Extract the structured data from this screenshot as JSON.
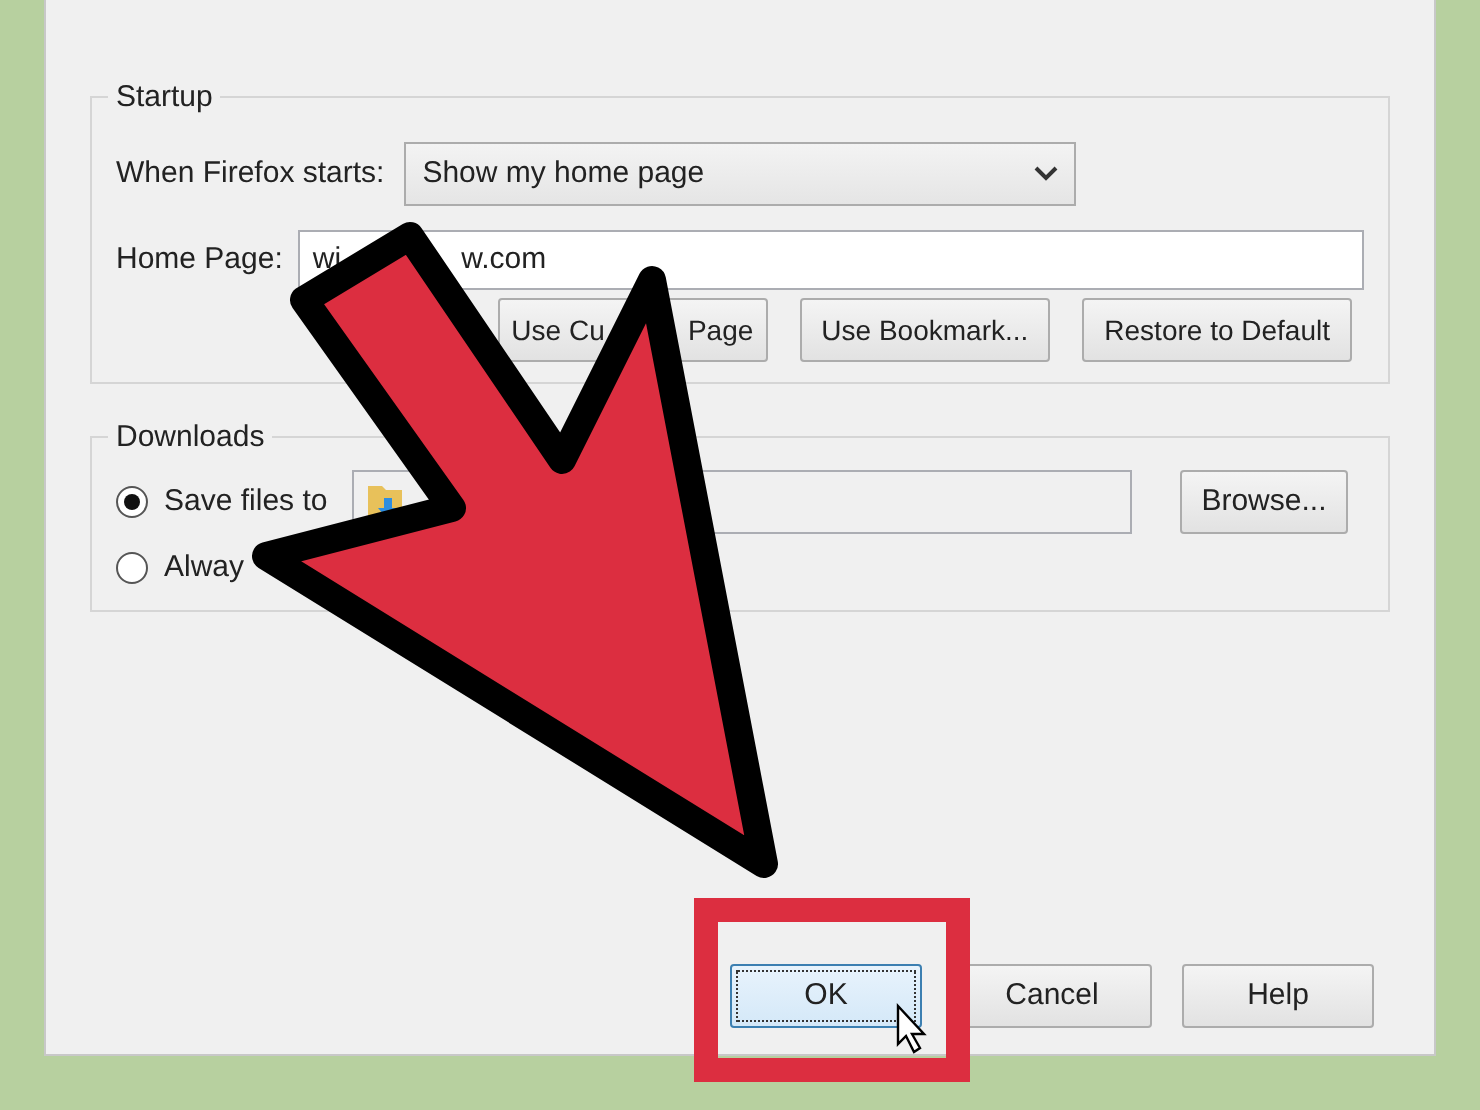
{
  "startup": {
    "title": "Startup",
    "when_label": "When Firefox starts:",
    "when_value": "Show my home page",
    "home_label": "Home Page:",
    "home_value_parts": [
      "wi",
      "w.com"
    ],
    "buttons": [
      {
        "label_parts": [
          "Use Cu",
          "Page"
        ]
      },
      {
        "label_parts": [
          "Use Bookmark..."
        ]
      },
      {
        "label_parts": [
          "Restore to Default"
        ]
      }
    ]
  },
  "downloads": {
    "title": "Downloads",
    "options": [
      {
        "label": "Save files to",
        "selected": true,
        "kind": "folder"
      },
      {
        "label": "Alway",
        "selected": false
      }
    ],
    "browse": "Browse..."
  },
  "footer_buttons": [
    {
      "label": "OK",
      "focused": true
    },
    {
      "label": "Cancel",
      "focused": false
    },
    {
      "label": "Help",
      "focused": false
    }
  ]
}
